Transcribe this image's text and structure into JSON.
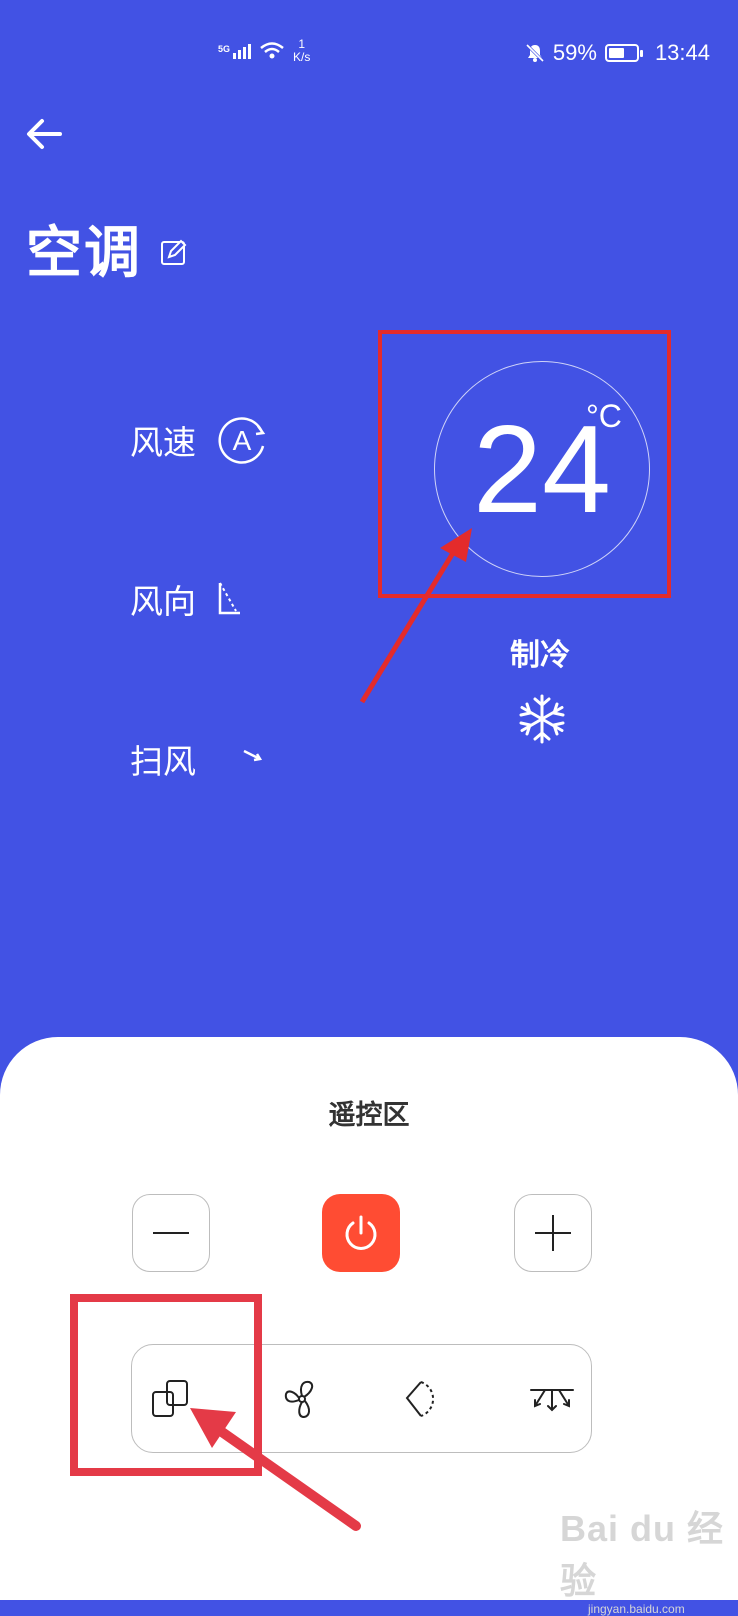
{
  "status_bar": {
    "network": "5G",
    "net_speed_value": "1",
    "net_speed_unit": "K/s",
    "battery_percent": "59%",
    "battery_level": 0.59,
    "time": "13:44"
  },
  "header": {
    "back_icon": "arrow-left-icon",
    "title": "空调",
    "edit_icon": "edit-icon"
  },
  "controls": {
    "fan_speed": {
      "label": "风速",
      "icon": "auto-fan-speed-icon"
    },
    "wind_direction": {
      "label": "风向",
      "icon": "wind-direction-icon"
    },
    "swing": {
      "label": "扫风",
      "icon": "swing-arrow-icon"
    }
  },
  "temperature": {
    "value": "24",
    "unit": "°C"
  },
  "mode": {
    "label": "制冷",
    "icon": "snowflake-icon"
  },
  "remote": {
    "title": "遥控区",
    "buttons": {
      "minus": "minus-icon",
      "power": "power-icon",
      "plus": "plus-icon"
    },
    "mode_buttons": [
      "mode-switch-icon",
      "fan-icon",
      "swing-diamond-icon",
      "airflow-icon"
    ]
  },
  "watermark": {
    "main": "Bai du 经验",
    "sub": "jingyan.baidu.com"
  },
  "colors": {
    "background": "#4252E4",
    "power_button": "#FF4C33",
    "highlight_box": "#E42B2B"
  }
}
